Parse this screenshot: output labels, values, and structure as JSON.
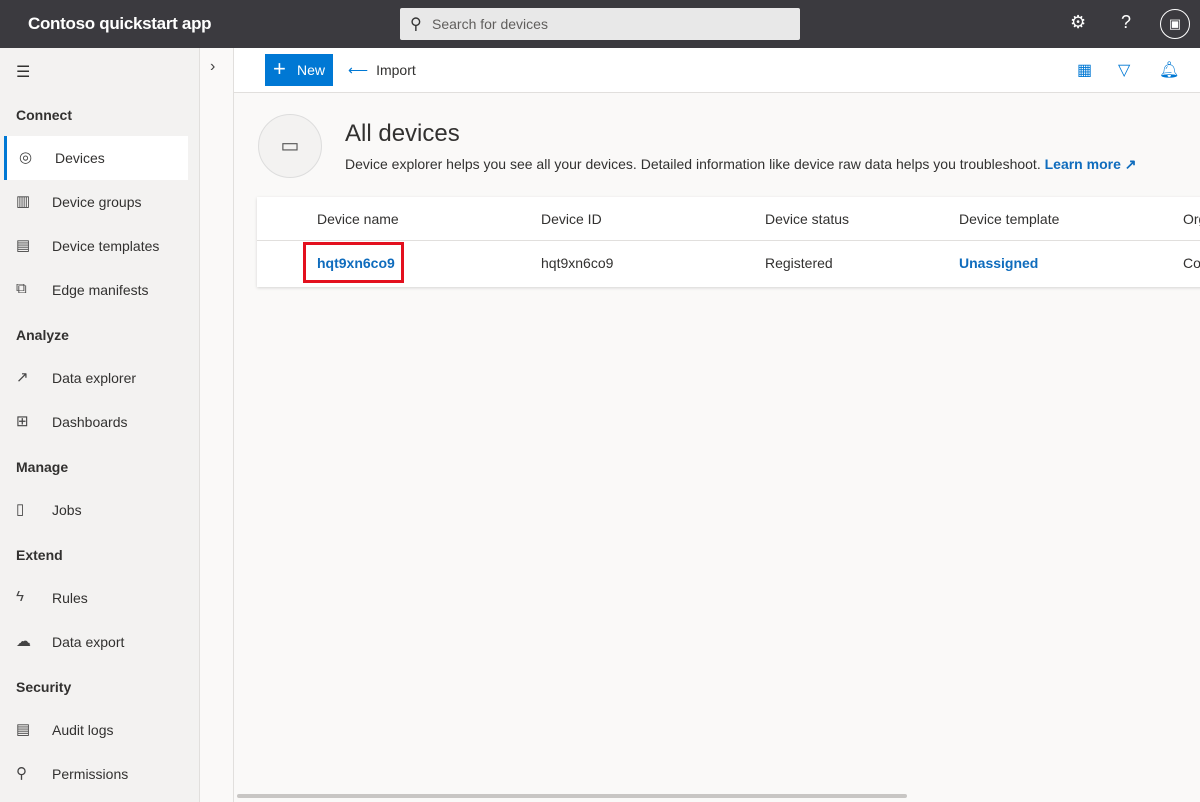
{
  "header": {
    "title": "Contoso quickstart app",
    "search_placeholder": "Search for devices",
    "settings_icon": "⚙",
    "help_icon": "?",
    "avatar_icon": "🪪"
  },
  "sidebar": {
    "sections": [
      "Connect",
      "Analyze",
      "Manage",
      "Extend",
      "Security"
    ],
    "items": [
      {
        "label": "Devices",
        "icon": "◎"
      },
      {
        "label": "Device groups",
        "icon": "▥"
      },
      {
        "label": "Device templates",
        "icon": "▤"
      },
      {
        "label": "Edge manifests",
        "icon": "⧉"
      },
      {
        "label": "Data explorer",
        "icon": "↗"
      },
      {
        "label": "Dashboards",
        "icon": "⊞"
      },
      {
        "label": "Jobs",
        "icon": "▯"
      },
      {
        "label": "Rules",
        "icon": "ϟ"
      },
      {
        "label": "Data export",
        "icon": "☁"
      },
      {
        "label": "Audit logs",
        "icon": "▤"
      },
      {
        "label": "Permissions",
        "icon": "⚲"
      }
    ]
  },
  "toolbar": {
    "new_label": "New",
    "import_label": "Import"
  },
  "page": {
    "title": "All devices",
    "description": "Device explorer helps you see all your devices. Detailed information like device raw data helps you troubleshoot.",
    "learn_more": "Learn more"
  },
  "table": {
    "columns": [
      "Device name",
      "Device ID",
      "Device status",
      "Device template",
      "Org"
    ],
    "rows": [
      {
        "name": "hqt9xn6co9",
        "id": "hqt9xn6co9",
        "status": "Registered",
        "template": "Unassigned",
        "org": "Co"
      }
    ]
  },
  "colors": {
    "accent": "#0078d4",
    "highlight": "#e3101e",
    "topbar": "#3b3a3f"
  }
}
